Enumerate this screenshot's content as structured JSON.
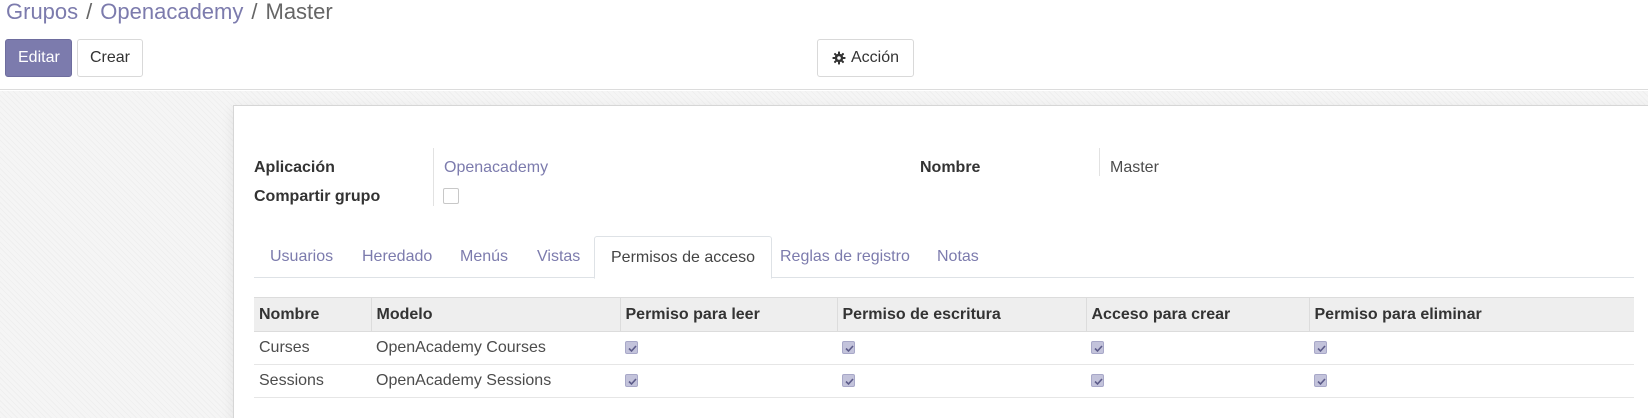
{
  "breadcrumb": {
    "root": "Grupos",
    "separator1": "/",
    "middle": "Openacademy",
    "separator2": "/",
    "current": "Master"
  },
  "toolbar": {
    "edit_label": "Editar",
    "create_label": "Crear",
    "action_label": "Acción"
  },
  "form": {
    "application_label": "Aplicación",
    "application_value": "Openacademy",
    "share_group_label": "Compartir grupo",
    "share_group_checked": false,
    "name_label": "Nombre",
    "name_value": "Master"
  },
  "tabs": [
    {
      "label": "Usuarios",
      "active": false
    },
    {
      "label": "Heredado",
      "active": false
    },
    {
      "label": "Menús",
      "active": false
    },
    {
      "label": "Vistas",
      "active": false
    },
    {
      "label": "Permisos de acceso",
      "active": true
    },
    {
      "label": "Reglas de registro",
      "active": false
    },
    {
      "label": "Notas",
      "active": false
    }
  ],
  "table": {
    "columns": [
      "Nombre",
      "Modelo",
      "Permiso para leer",
      "Permiso de escritura",
      "Acceso para crear",
      "Permiso para eliminar"
    ],
    "rows": [
      {
        "name": "Curses",
        "model": "OpenAcademy Courses",
        "read": true,
        "write": true,
        "create": true,
        "delete": true
      },
      {
        "name": "Sessions",
        "model": "OpenAcademy Sessions",
        "read": true,
        "write": true,
        "create": true,
        "delete": true
      }
    ]
  },
  "colors": {
    "primary": "#7c7bad",
    "checkbox_checked": "#c3c3db"
  },
  "icons": {
    "action": "gear-icon",
    "checkbox": "check-icon"
  }
}
